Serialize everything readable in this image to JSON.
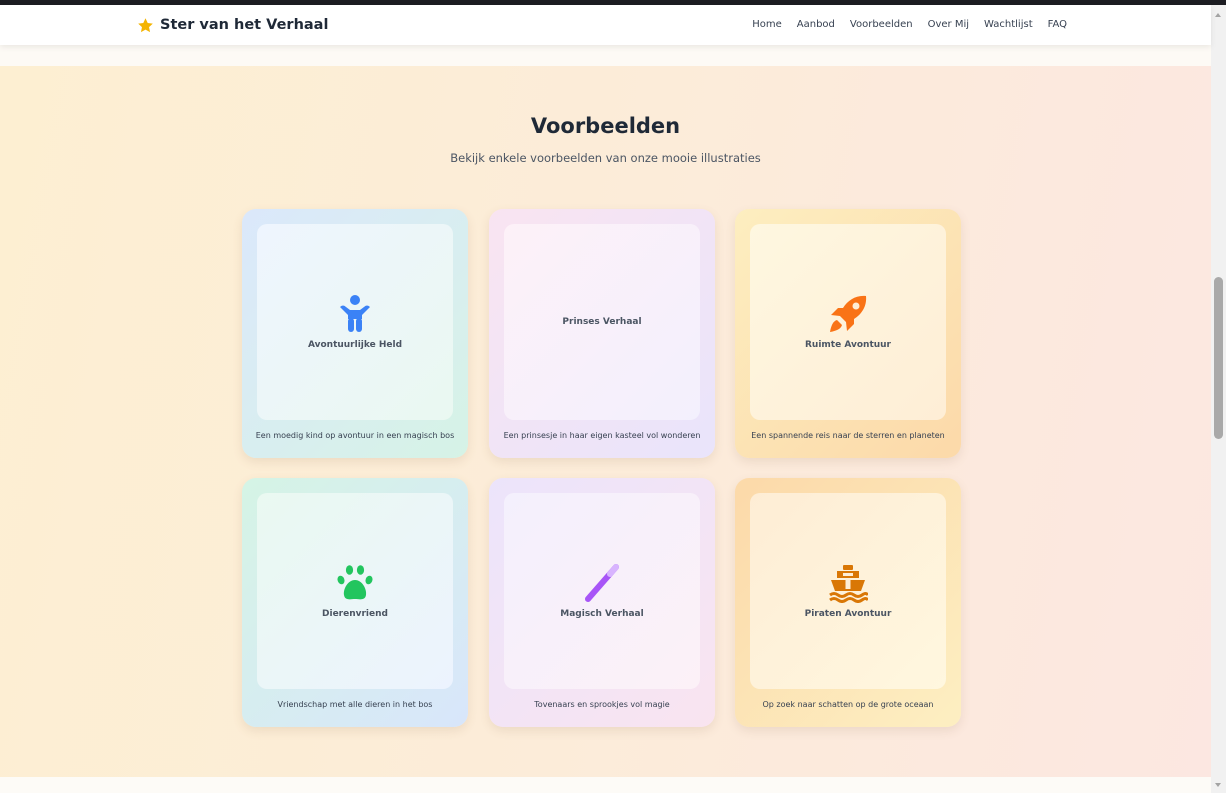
{
  "brand": {
    "name": "Ster van het Verhaal",
    "icon": "star-icon",
    "icon_color": "#f4b400"
  },
  "nav": {
    "items": [
      "Home",
      "Aanbod",
      "Voorbeelden",
      "Over Mij",
      "Wachtlijst",
      "FAQ"
    ]
  },
  "section": {
    "title": "Voorbeelden",
    "subtitle": "Bekijk enkele voorbeelden van onze mooie illustraties"
  },
  "cards": [
    {
      "title": "Avontuurlijke Held",
      "caption": "Een moedig kind op avontuur in een magisch bos",
      "icon": "child-icon",
      "icon_color": "#3b82f6"
    },
    {
      "title": "Prinses Verhaal",
      "caption": "Een prinsesje in haar eigen kasteel vol wonderen",
      "icon": "",
      "icon_color": ""
    },
    {
      "title": "Ruimte Avontuur",
      "caption": "Een spannende reis naar de sterren en planeten",
      "icon": "rocket-icon",
      "icon_color": "#f97316"
    },
    {
      "title": "Dierenvriend",
      "caption": "Vriendschap met alle dieren in het bos",
      "icon": "paw-icon",
      "icon_color": "#22c55e"
    },
    {
      "title": "Magisch Verhaal",
      "caption": "Tovenaars en sprookjes vol magie",
      "icon": "magic-wand-icon",
      "icon_color": "#a855f7"
    },
    {
      "title": "Piraten Avontuur",
      "caption": "Op zoek naar schatten op de grote oceaan",
      "icon": "ship-icon",
      "icon_color": "#d97706"
    }
  ]
}
